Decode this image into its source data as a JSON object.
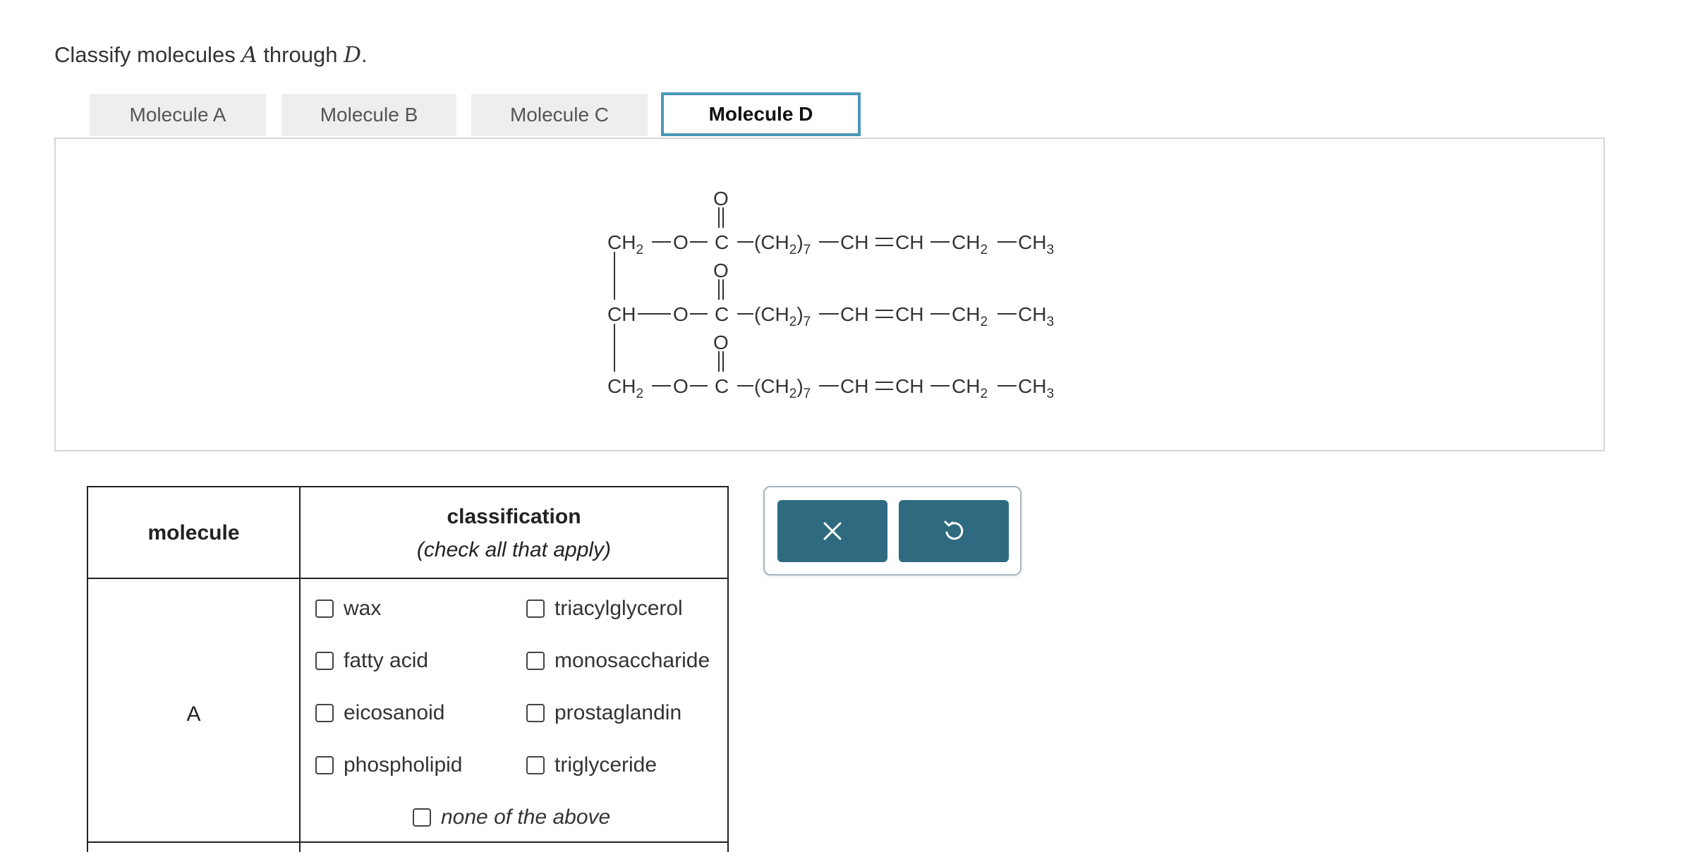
{
  "question": {
    "prefix": "Classify molecules ",
    "var_a": "A",
    "middle": " through ",
    "var_d": "D",
    "suffix": "."
  },
  "tabs": [
    {
      "label": "Molecule A",
      "active": false
    },
    {
      "label": "Molecule B",
      "active": false
    },
    {
      "label": "Molecule C",
      "active": false
    },
    {
      "label": "Molecule D",
      "active": true
    }
  ],
  "molecule": {
    "carbonyl_o": "O",
    "ester_o": "O",
    "c": "C",
    "glycerol": [
      "CH",
      "CH",
      "CH"
    ],
    "chain": {
      "ch2n": "(CH",
      "ch2n_sub": "2",
      "ch2n_close": ")",
      "n": "7",
      "ch_a": "CH",
      "ch_b": "CH",
      "ch2": "CH",
      "ch2_sub": "2",
      "ch3": "CH",
      "ch3_sub": "3"
    },
    "glycerol_sub": "2"
  },
  "table": {
    "header_molecule": "molecule",
    "header_classification": "classification",
    "header_hint": "(check all that apply)",
    "row_label": "A",
    "options_left": [
      "wax",
      "fatty acid",
      "eicosanoid",
      "phospholipid"
    ],
    "options_right": [
      "triacylglycerol",
      "monosaccharide",
      "prostaglandin",
      "triglyceride"
    ],
    "none_option": "none of the above"
  },
  "actions": {
    "clear_icon": "x-icon",
    "reset_icon": "undo-icon",
    "button_color": "#2e6b80"
  },
  "colors": {
    "active_tab_border": "#4a97b7",
    "inactive_tab_bg": "#eeeeee"
  }
}
